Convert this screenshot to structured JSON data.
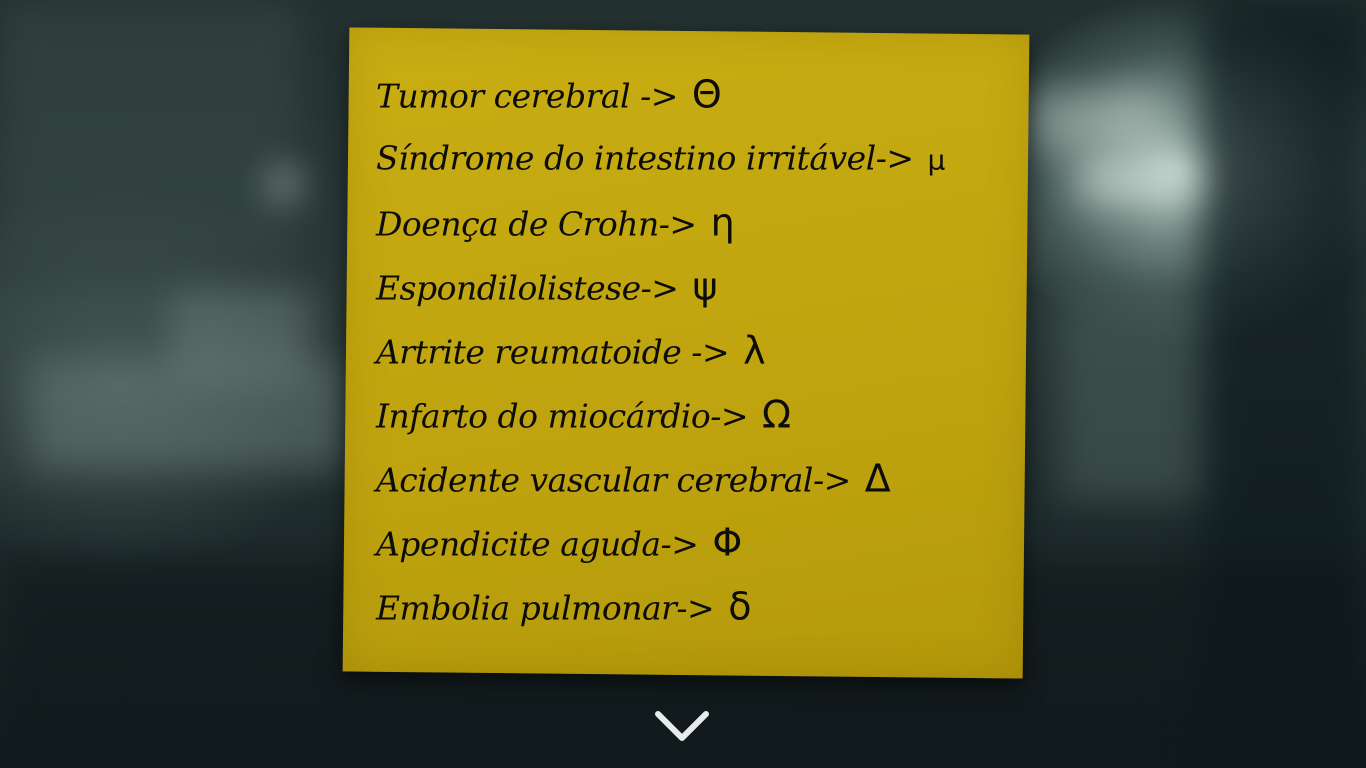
{
  "note": {
    "entries": [
      {
        "label": "Tumor cerebral ->",
        "symbol": "Θ"
      },
      {
        "label": "Síndrome do intestino irritável->",
        "symbol": "μ"
      },
      {
        "label": "Doença de Crohn->",
        "symbol": "η"
      },
      {
        "label": "Espondilolistese->",
        "symbol": "ψ"
      },
      {
        "label": "Artrite reumatoide ->",
        "symbol": "λ"
      },
      {
        "label": "Infarto do miocárdio->",
        "symbol": "Ω"
      },
      {
        "label": "Acidente vascular cerebral->",
        "symbol": "Δ"
      },
      {
        "label": "Apendicite aguda->",
        "symbol": "Φ"
      },
      {
        "label": "Embolia pulmonar->",
        "symbol": "δ"
      }
    ]
  },
  "controls": {
    "close_icon": "chevron-down-icon"
  },
  "colors": {
    "note": "#c9ad12",
    "ink": "#0c0c08",
    "chevron": "#e6ecec"
  }
}
